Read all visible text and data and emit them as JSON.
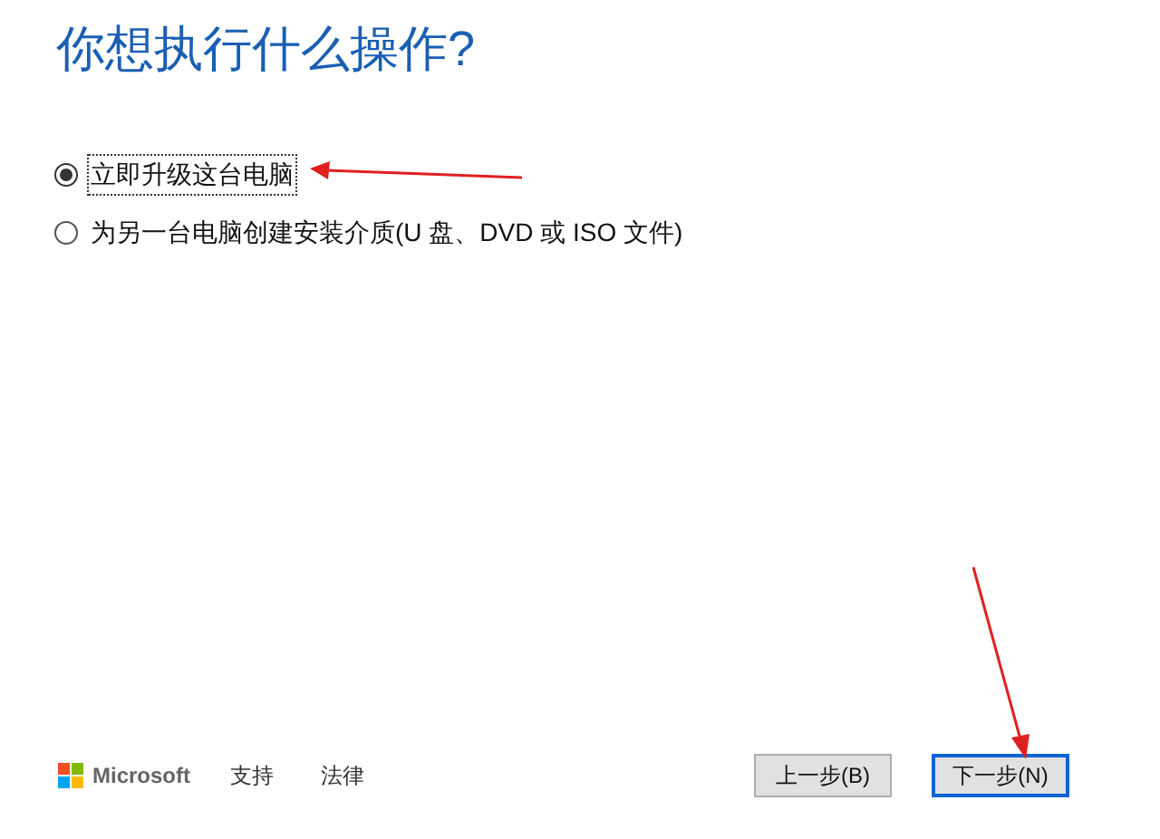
{
  "title": "你想执行什么操作?",
  "options": [
    {
      "label": "立即升级这台电脑",
      "selected": true
    },
    {
      "label": "为另一台电脑创建安装介质(U 盘、DVD 或 ISO 文件)",
      "selected": false
    }
  ],
  "footer": {
    "brand": "Microsoft",
    "links": [
      "支持",
      "法律"
    ]
  },
  "buttons": [
    {
      "label": "上一步(B)",
      "kind": "secondary"
    },
    {
      "label": "下一步(N)",
      "kind": "primary"
    }
  ]
}
